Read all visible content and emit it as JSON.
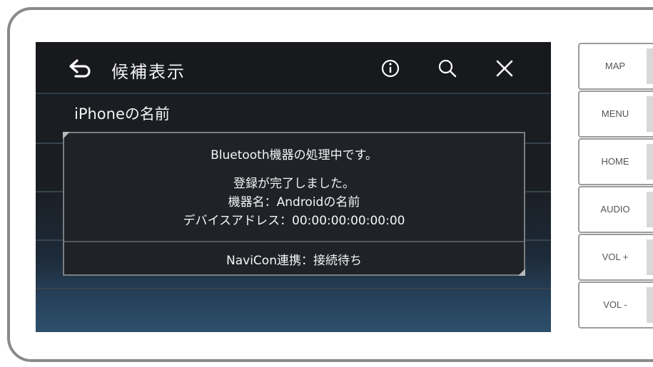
{
  "header": {
    "title": "候補表示",
    "back_icon": "back-arrow-icon",
    "info_icon": "info-icon",
    "search_icon": "search-icon",
    "close_icon": "close-icon"
  },
  "list": {
    "row1_label": "iPhoneの名前"
  },
  "dialog": {
    "line1": "Bluetooth機器の処理中です。",
    "line2": "登録が完了しました。",
    "line3": "機器名：Androidの名前",
    "line4": "デバイスアドレス：00:00:00:00:00:00",
    "line5": "NaviCon連携：接続待ち"
  },
  "side_buttons": {
    "map": "MAP",
    "menu": "MENU",
    "home": "HOME",
    "audio": "AUDIO",
    "vol_up": "VOL +",
    "vol_down": "VOL -"
  },
  "colors": {
    "screen_bg": "#1a1d21",
    "text": "#f2f2f2",
    "bezel": "#8a8a8a"
  }
}
